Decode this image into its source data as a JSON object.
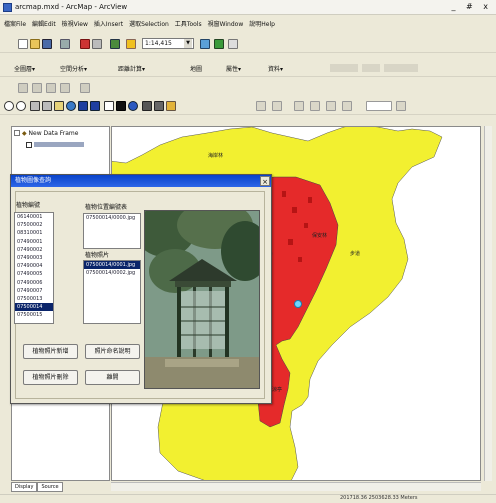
{
  "window": {
    "title": "arcmap.mxd - ArcMap - ArcView",
    "controls": "_ # x"
  },
  "menubar": {
    "items": [
      "檔案File",
      "編輯Edit",
      "檢視View",
      "插入Insert",
      "選取Selection",
      "工具Tools",
      "視窗Window",
      "說明Help"
    ]
  },
  "toolbar": {
    "scale": "1:14,415"
  },
  "map_toolbar": {
    "items": [
      "全圖層▾",
      "空間分析▾",
      "距離計算▾",
      "地圖",
      "屬性▾",
      "資料▾"
    ]
  },
  "toc": {
    "root": "New Data Frame",
    "tabs": [
      "Display",
      "Source"
    ]
  },
  "dialog": {
    "title": "植物圖像查詢",
    "id_label": "植物編號",
    "location_label": "植物位置編號表",
    "photo_label": "植物照片",
    "ids": [
      "06140001",
      "07500002",
      "08310001",
      "07490001",
      "07490002",
      "07490003",
      "07490004",
      "07490005",
      "07490006",
      "07490007",
      "07500013",
      "07500014",
      "07500015"
    ],
    "selected_index": 11,
    "location_items": [
      "07500014/0000.jpg"
    ],
    "photos": [
      "07500014/0001.jpg",
      "07500014/0002.jpg"
    ],
    "selected_photo": 0,
    "buttons": {
      "add": "植物照片新增",
      "rename": "照片命名說明",
      "delete": "植物照片刪除",
      "close": "離開"
    }
  },
  "map": {
    "labels": [
      "海岸林",
      "保安林",
      "步道",
      "涼亭"
    ]
  },
  "status": {
    "coords": "201718.36 2503628.33 Meters"
  },
  "colors": {
    "titlebar": "#0a43c9",
    "map_yellow": "#f2f030",
    "map_red": "#e52a2a"
  }
}
